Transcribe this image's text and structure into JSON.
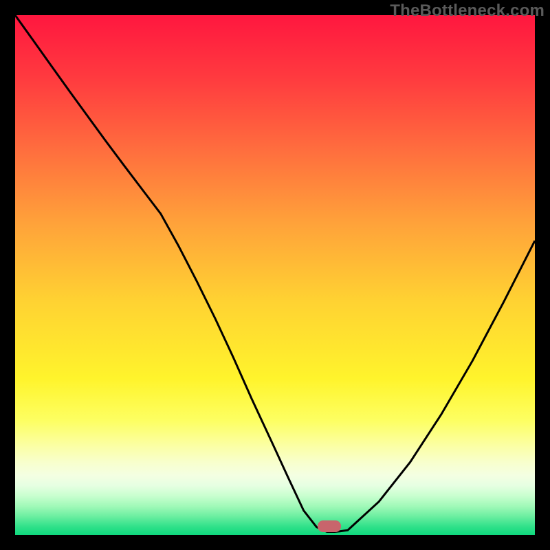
{
  "watermark": "TheBottleneck.com",
  "chart_data": {
    "type": "line",
    "title": "",
    "xlabel": "",
    "ylabel": "",
    "xlim": [
      0,
      100
    ],
    "ylim": [
      0,
      100
    ],
    "grid": false,
    "legend": false,
    "series": [
      {
        "name": "bottleneck-curve",
        "x": [
          0,
          3.5,
          7,
          10.5,
          14,
          17.5,
          21,
          24.5,
          28,
          31.5,
          35,
          38.5,
          42,
          45.5,
          49.6,
          52.5,
          55.5,
          58,
          60,
          61.5,
          62.5,
          64,
          70,
          76,
          82,
          88,
          94,
          100
        ],
        "y": [
          100,
          95.1,
          90.2,
          85.3,
          80.5,
          75.7,
          71.0,
          66.4,
          61.8,
          55.5,
          48.7,
          41.6,
          34.1,
          26.2,
          17.4,
          11.1,
          4.7,
          1.5,
          0.6,
          0.6,
          0.7,
          0.9,
          6.4,
          14.0,
          23.2,
          33.5,
          44.8,
          56.6
        ]
      }
    ],
    "marker": {
      "x_center": 60.5,
      "width": 4.5,
      "y": 0.5,
      "height": 2.3
    },
    "gradient_stops": [
      {
        "pos": 0.0,
        "color": "#ff173f"
      },
      {
        "pos": 0.12,
        "color": "#ff3a3f"
      },
      {
        "pos": 0.25,
        "color": "#ff6a3e"
      },
      {
        "pos": 0.4,
        "color": "#ffa23a"
      },
      {
        "pos": 0.55,
        "color": "#ffd232"
      },
      {
        "pos": 0.7,
        "color": "#fff42c"
      },
      {
        "pos": 0.78,
        "color": "#fdff62"
      },
      {
        "pos": 0.83,
        "color": "#fbffa6"
      },
      {
        "pos": 0.86,
        "color": "#f8ffcc"
      },
      {
        "pos": 0.885,
        "color": "#f4ffe2"
      },
      {
        "pos": 0.905,
        "color": "#e6ffe2"
      },
      {
        "pos": 0.925,
        "color": "#c8ffcf"
      },
      {
        "pos": 0.945,
        "color": "#a0f9b8"
      },
      {
        "pos": 0.965,
        "color": "#6aeea0"
      },
      {
        "pos": 0.985,
        "color": "#2ee089"
      },
      {
        "pos": 1.0,
        "color": "#0fd97e"
      }
    ]
  }
}
